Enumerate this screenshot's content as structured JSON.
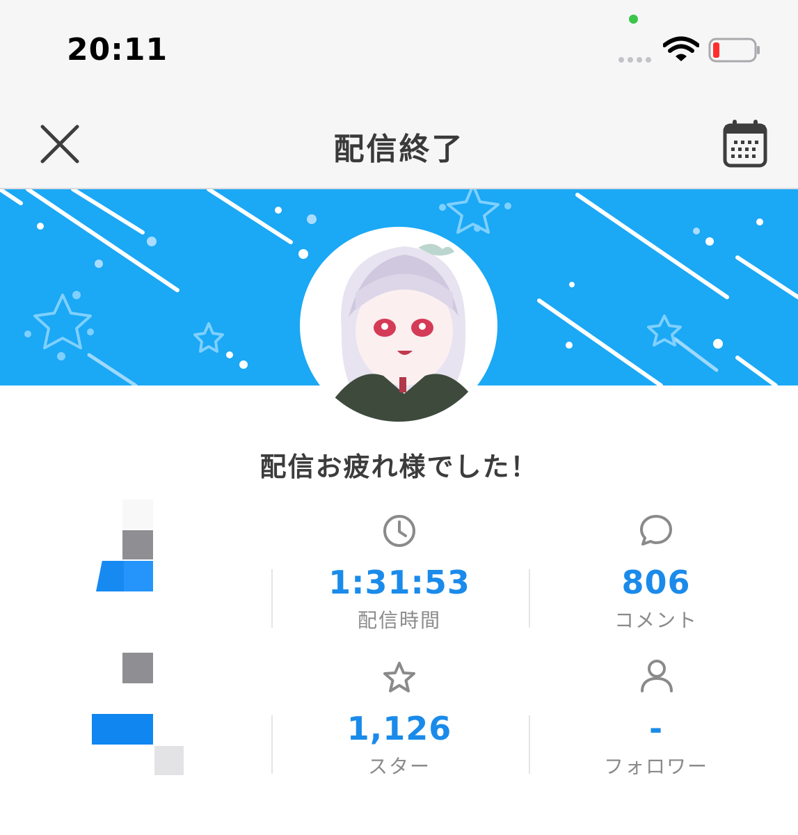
{
  "status_bar": {
    "time": "20:11"
  },
  "nav": {
    "title": "配信終了"
  },
  "message": "配信お疲れ様でした！",
  "stats": [
    {
      "value": "1:31:53",
      "label": "配信時間",
      "icon": "clock-icon"
    },
    {
      "value": "806",
      "label": "コメント",
      "icon": "comment-icon"
    },
    {
      "value": "1,126",
      "label": "スター",
      "icon": "star-icon"
    },
    {
      "value": "-",
      "label": "フォロワー",
      "icon": "person-icon"
    }
  ],
  "colors": {
    "banner": "#1ba8f5",
    "accent": "#1a8bea",
    "label": "#8a8a8a"
  }
}
